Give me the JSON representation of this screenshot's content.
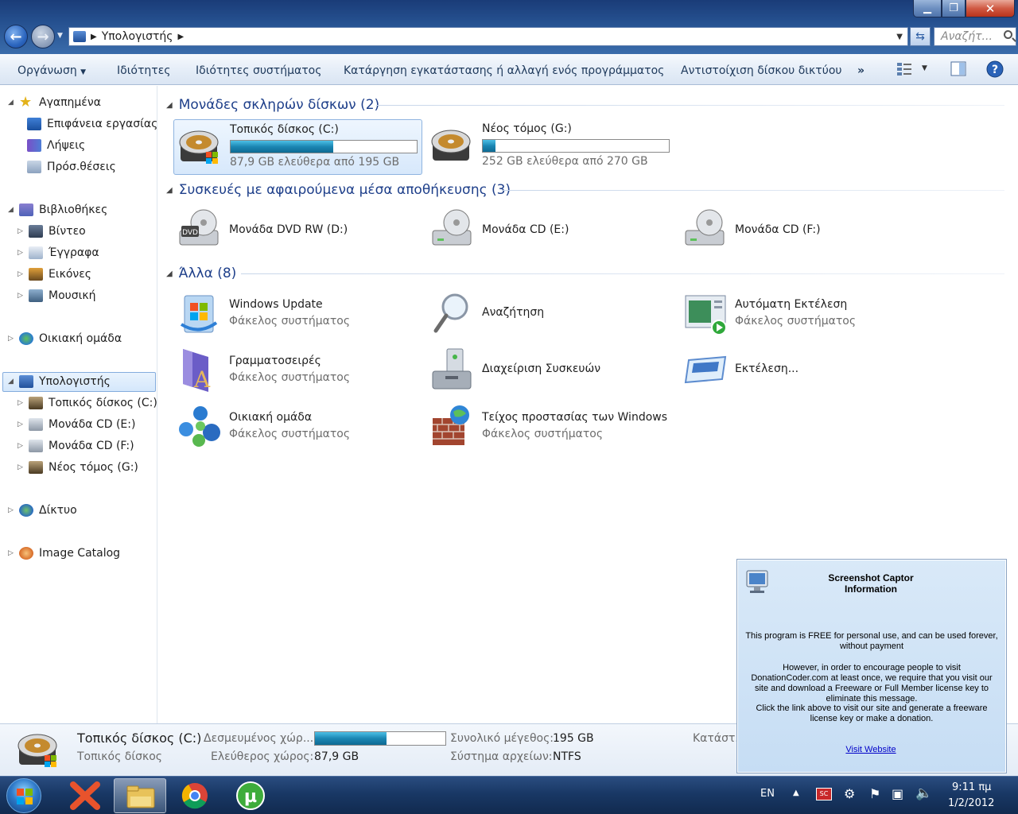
{
  "address": {
    "breadcrumb": "Υπολογιστής",
    "search_placeholder": "Αναζήτ..."
  },
  "toolbar": {
    "organize": "Οργάνωση",
    "properties": "Ιδιότητες",
    "system_properties": "Ιδιότητες συστήματος",
    "uninstall": "Κατάργηση εγκατάστασης ή αλλαγή ενός προγράμματος",
    "map_drive": "Αντιστοίχιση δίσκου δικτύου",
    "more": "»"
  },
  "navpane": {
    "favorites": "Αγαπημένα",
    "desktop": "Επιφάνεια εργασίας",
    "downloads": "Λήψεις",
    "recent": "Πρόσ.θέσεις",
    "libraries": "Βιβλιοθήκες",
    "videos": "Βίντεο",
    "documents": "Έγγραφα",
    "pictures": "Εικόνες",
    "music": "Μουσική",
    "homegroup": "Οικιακή ομάδα",
    "computer": "Υπολογιστής",
    "local_disk_c": "Τοπικός δίσκος (C:)",
    "cd_e": "Μονάδα CD (E:)",
    "cd_f": "Μονάδα CD (F:)",
    "new_volume_g": "Νέος τόμος (G:)",
    "network": "Δίκτυο",
    "image_catalog": "Image Catalog"
  },
  "groups": {
    "hard_disks": "Μονάδες σκληρών δίσκων (2)",
    "removable": "Συσκευές με αφαιρούμενα μέσα αποθήκευσης (3)",
    "other": "Άλλα (8)"
  },
  "drives": [
    {
      "name": "Τοπικός δίσκος (C:)",
      "free": "87,9 GB ελεύθερα από 195 GB",
      "used_fraction": 0.55
    },
    {
      "name": "Νέος τόμος (G:)",
      "free": "252 GB ελεύθερα από 270 GB",
      "used_fraction": 0.07
    }
  ],
  "removable": [
    {
      "name": "Μονάδα DVD RW (D:)"
    },
    {
      "name": "Μονάδα CD (E:)"
    },
    {
      "name": "Μονάδα CD (F:)"
    }
  ],
  "other": [
    {
      "name": "Windows Update",
      "sub": "Φάκελος συστήματος"
    },
    {
      "name": "Αναζήτηση",
      "sub": ""
    },
    {
      "name": "Αυτόματη Εκτέλεση",
      "sub": "Φάκελος συστήματος"
    },
    {
      "name": "Γραμματοσειρές",
      "sub": "Φάκελος συστήματος"
    },
    {
      "name": "Διαχείριση Συσκευών",
      "sub": ""
    },
    {
      "name": "Εκτέλεση...",
      "sub": ""
    },
    {
      "name": "Οικιακή ομάδα",
      "sub": "Φάκελος συστήματος"
    },
    {
      "name": "Τείχος προστασίας των Windows",
      "sub": "Φάκελος συστήματος"
    }
  ],
  "details": {
    "name": "Τοπικός δίσκος (C:)",
    "type": "Τοπικός δίσκος",
    "used_label": "Δεσμευμένος χώρ...",
    "used_fraction": 0.55,
    "free_label": "Ελεύθερος χώρος:",
    "free_value": "87,9 GB",
    "total_label": "Συνολικό μέγεθος:",
    "total_value": "195 GB",
    "fs_label": "Σύστημα αρχείων:",
    "fs_value": "NTFS",
    "state_label": "Κατάστ..."
  },
  "popup": {
    "title_line1": "Screenshot Captor",
    "title_line2": "Information",
    "p1": "This program is FREE for personal use, and can be used forever, without payment",
    "p2": "However, in order to encourage people to visit DonationCoder.com at least once, we require that you visit our site and download a Freeware or Full Member license key to eliminate this message.",
    "p3": "Click the link above to visit our site and generate a freeware license key or make a donation.",
    "link": "Visit Website"
  },
  "taskbar": {
    "lang": "EN",
    "time": "9:11 πμ",
    "date": "1/2/2012"
  },
  "colors": {
    "accent": "#1e3f8a",
    "progress": "#1b86b3",
    "taskbar": "#193865"
  }
}
